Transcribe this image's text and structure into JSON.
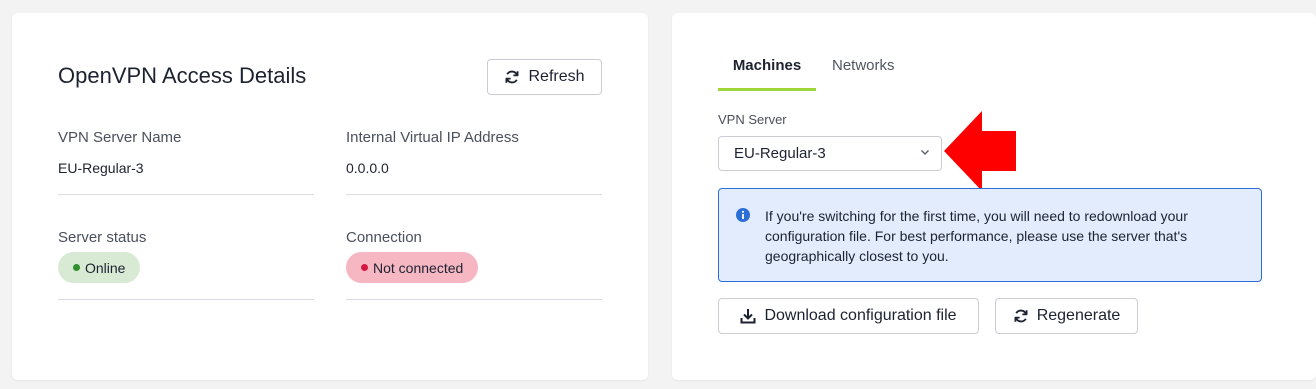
{
  "access_card": {
    "title": "OpenVPN Access Details",
    "refresh_label": "Refresh",
    "fields": {
      "server_name_label": "VPN Server Name",
      "server_name_value": "EU-Regular-3",
      "ip_label": "Internal Virtual IP Address",
      "ip_value": "0.0.0.0",
      "status_label": "Server status",
      "status_value": "Online",
      "connection_label": "Connection",
      "connection_value": "Not connected"
    }
  },
  "config_card": {
    "tabs": [
      {
        "label": "Machines",
        "active": true
      },
      {
        "label": "Networks",
        "active": false
      }
    ],
    "vpn_server_label": "VPN Server",
    "vpn_server_selected": "EU-Regular-3",
    "info_message": "If you're switching for the first time, you will need to redownload your configuration file. For best performance, please use the server that's geographically closest to you.",
    "download_label": "Download configuration file",
    "regenerate_label": "Regenerate"
  },
  "icons": {
    "refresh": "refresh-icon",
    "chevron": "chevron-down-icon",
    "info": "info-icon",
    "download": "download-icon",
    "pointer": "red-arrow-left-icon"
  },
  "colors": {
    "tab_underline": "#9fd63a",
    "online_badge": "#d8ead4",
    "online_dot": "#2f8f2f",
    "not_connected_badge": "#f6b7c3",
    "not_connected_dot": "#d41940",
    "info_bg": "#e3ecfc",
    "info_border": "#2b6fd6",
    "arrow": "#ff0000"
  }
}
